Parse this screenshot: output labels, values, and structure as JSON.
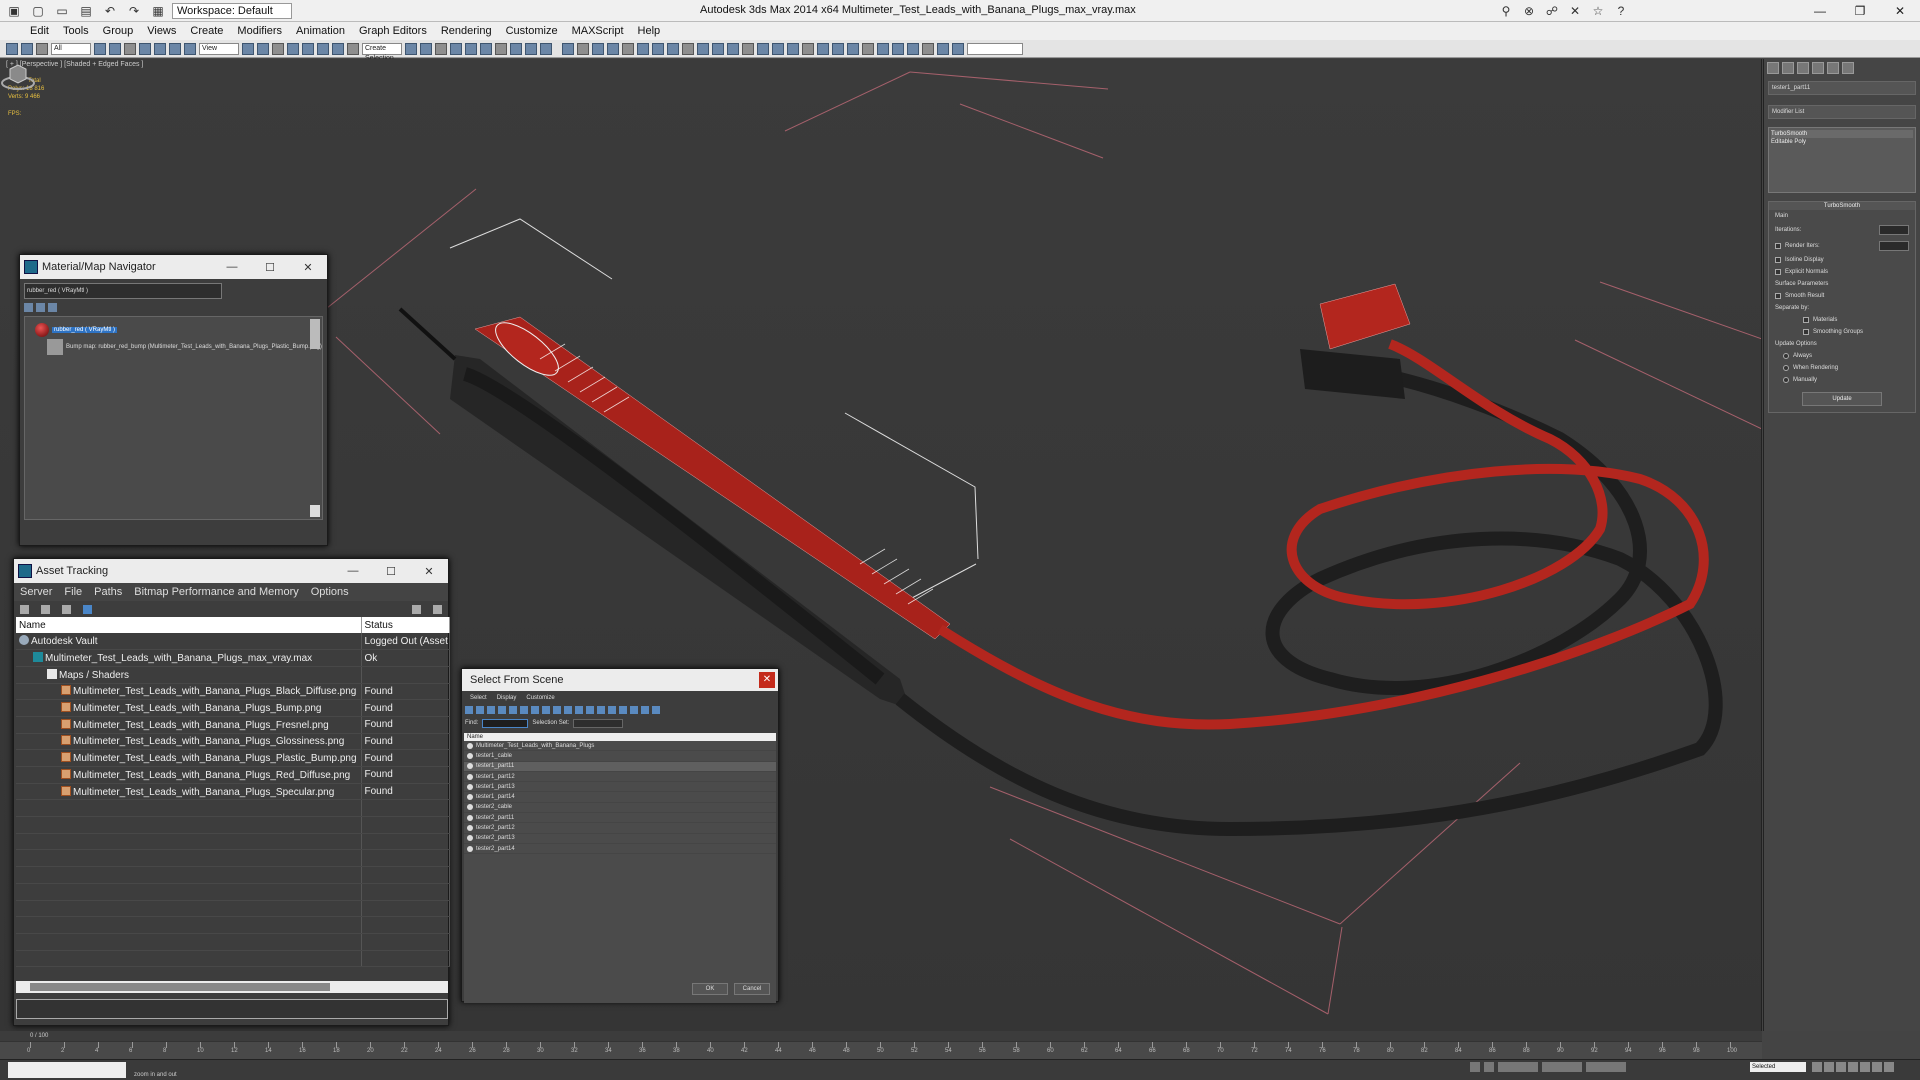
{
  "app": {
    "title": "Autodesk 3ds Max  2014 x64     Multimeter_Test_Leads_with_Banana_Plugs_max_vray.max",
    "workspace": "Workspace: Default"
  },
  "menubar": [
    "Edit",
    "Tools",
    "Group",
    "Views",
    "Create",
    "Modifiers",
    "Animation",
    "Graph Editors",
    "Rendering",
    "Customize",
    "MAXScript",
    "Help"
  ],
  "toolbar": {
    "filter": "All",
    "view": "View",
    "selection_set": "Create Selection"
  },
  "viewport": {
    "label": "[ + ] [Perspective ] [Shaded + Edged Faces ]",
    "stats": {
      "total": "Total",
      "polys": "Polys:  18 816",
      "verts": "Verts:   9 466",
      "fps": "FPS:"
    }
  },
  "command_panel": {
    "object_name": "tester1_part11",
    "modifier_list": "Modifier List",
    "stack": [
      "TurboSmooth",
      "Editable Poly"
    ],
    "rollout_title": "TurboSmooth",
    "main": "Main",
    "iterations": "Iterations:",
    "render_iters": "Render Iters:",
    "isoline": "Isoline Display",
    "explicit_normals": "Explicit Normals",
    "surface_params": "Surface Parameters",
    "smooth_result": "Smooth Result",
    "separate_by": "Separate by:",
    "materials": "Materials",
    "smoothing_groups": "Smoothing Groups",
    "update_options": "Update Options",
    "always": "Always",
    "when_rendering": "When Rendering",
    "manually": "Manually",
    "update": "Update"
  },
  "material_navigator": {
    "title": "Material/Map Navigator",
    "field": "rubber_red  ( VRayMtl )",
    "node_material": "rubber_red  ( VRayMtl )",
    "node_map": "Bump map: rubber_red_bump (Multimeter_Test_Leads_with_Banana_Plugs_Plastic_Bump.png)"
  },
  "asset_tracking": {
    "title": "Asset Tracking",
    "menu": [
      "Server",
      "File",
      "Paths",
      "Bitmap Performance and Memory",
      "Options"
    ],
    "columns": [
      "Name",
      "Status"
    ],
    "rows": [
      {
        "name": "Autodesk Vault",
        "status": "Logged Out (Asset",
        "icon": "vault-icon",
        "indent": 0
      },
      {
        "name": "Multimeter_Test_Leads_with_Banana_Plugs_max_vray.max",
        "status": "Ok",
        "icon": "max-file-icon",
        "indent": 1
      },
      {
        "name": "Maps / Shaders",
        "status": "",
        "icon": "folder-icon",
        "indent": 2
      },
      {
        "name": "Multimeter_Test_Leads_with_Banana_Plugs_Black_Diffuse.png",
        "status": "Found",
        "icon": "png-icon",
        "indent": 3
      },
      {
        "name": "Multimeter_Test_Leads_with_Banana_Plugs_Bump.png",
        "status": "Found",
        "icon": "png-icon",
        "indent": 3
      },
      {
        "name": "Multimeter_Test_Leads_with_Banana_Plugs_Fresnel.png",
        "status": "Found",
        "icon": "png-icon",
        "indent": 3
      },
      {
        "name": "Multimeter_Test_Leads_with_Banana_Plugs_Glossiness.png",
        "status": "Found",
        "icon": "png-icon",
        "indent": 3
      },
      {
        "name": "Multimeter_Test_Leads_with_Banana_Plugs_Plastic_Bump.png",
        "status": "Found",
        "icon": "png-icon",
        "indent": 3
      },
      {
        "name": "Multimeter_Test_Leads_with_Banana_Plugs_Red_Diffuse.png",
        "status": "Found",
        "icon": "png-icon",
        "indent": 3
      },
      {
        "name": "Multimeter_Test_Leads_with_Banana_Plugs_Specular.png",
        "status": "Found",
        "icon": "png-icon",
        "indent": 3
      }
    ]
  },
  "select_from_scene": {
    "title": "Select From Scene",
    "menu": [
      "Select",
      "Display",
      "Customize"
    ],
    "find_label": "Find:",
    "selection_set_label": "Selection Set:",
    "column": "Name",
    "items": [
      {
        "name": "Multimeter_Test_Leads_with_Banana_Plugs",
        "selected": false
      },
      {
        "name": "tester1_cable",
        "selected": false
      },
      {
        "name": "tester1_part11",
        "selected": true
      },
      {
        "name": "tester1_part12",
        "selected": false
      },
      {
        "name": "tester1_part13",
        "selected": false
      },
      {
        "name": "tester1_part14",
        "selected": false
      },
      {
        "name": "tester2_cable",
        "selected": false
      },
      {
        "name": "tester2_part11",
        "selected": false
      },
      {
        "name": "tester2_part12",
        "selected": false
      },
      {
        "name": "tester2_part13",
        "selected": false
      },
      {
        "name": "tester2_part14",
        "selected": false
      }
    ],
    "ok": "OK",
    "cancel": "Cancel"
  },
  "timeline": {
    "frame": "0 / 100",
    "ticks": [
      "0",
      "2",
      "4",
      "6",
      "8",
      "10",
      "12",
      "14",
      "16",
      "18",
      "20",
      "22",
      "24",
      "26",
      "28",
      "30",
      "32",
      "34",
      "36",
      "38",
      "40",
      "42",
      "44",
      "46",
      "48",
      "50",
      "52",
      "54",
      "56",
      "58",
      "60",
      "62",
      "64",
      "66",
      "68",
      "70",
      "72",
      "74",
      "76",
      "78",
      "80",
      "82",
      "84",
      "86",
      "88",
      "90",
      "92",
      "94",
      "96",
      "98",
      "100"
    ]
  },
  "statusbar": {
    "prompt": "zoom in and out",
    "key_mode": "Selected"
  },
  "colors": {
    "red_lead": "#b8241c",
    "black_lead": "#2a2a2a",
    "selection": "#2e73c4"
  }
}
